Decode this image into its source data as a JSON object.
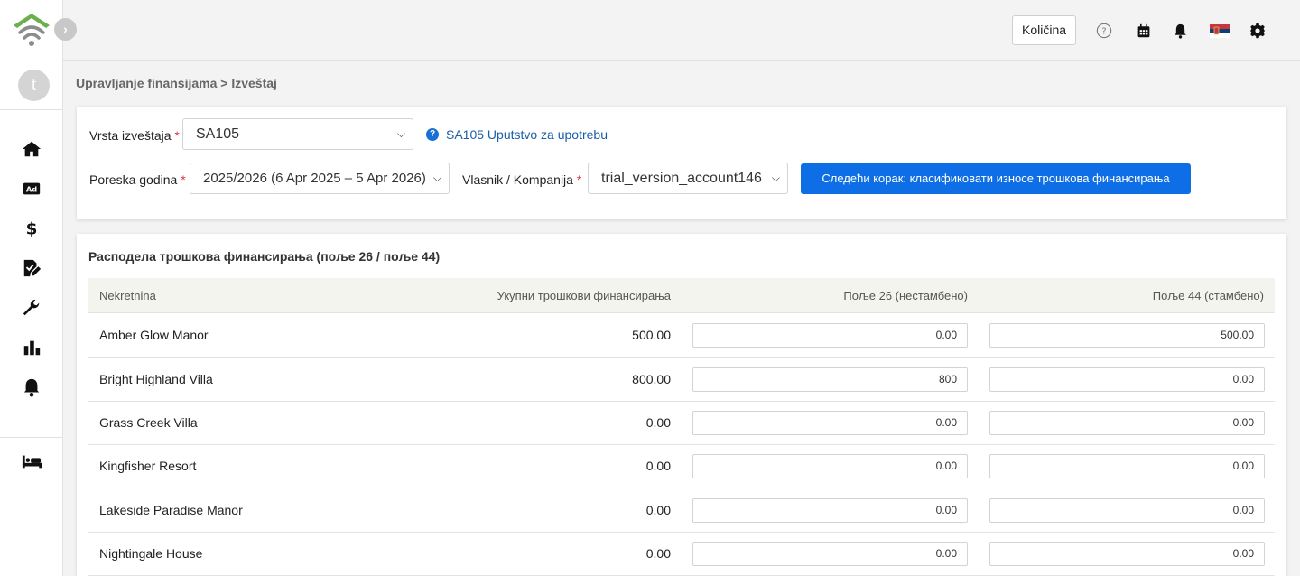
{
  "topbar": {
    "quantity_label": "Količina",
    "icons": [
      "help-icon",
      "calendar-icon",
      "bell-icon",
      "serbia-flag-icon",
      "gear-icon"
    ]
  },
  "sidebar": {
    "avatar_initial": "t",
    "icons": [
      "home-icon",
      "ad-icon",
      "dollar-icon",
      "document-edit-icon",
      "wrench-icon",
      "bar-chart-icon",
      "bell-icon",
      "bed-icon"
    ]
  },
  "breadcrumb": "Upravljanje finansijama > Izveštaj",
  "form": {
    "report_type_label": "Vrsta izveštaja",
    "report_type_value": "SA105",
    "help_link": "SA105 Uputstvo za upotrebu",
    "tax_year_label": "Poreska godina",
    "tax_year_value": "2025/2026 (6 Apr 2025 – 5 Apr 2026)",
    "owner_label": "Vlasnik / Kompanija",
    "owner_value": "trial_version_account146",
    "required_mark": "*",
    "next_button": "Следећи корак: класификовати износе трошкова финансирања"
  },
  "table": {
    "title": "Расподела трошкова финансирања (поље 26 / поље 44)",
    "columns": [
      "Nekretnina",
      "Укупни трошкови финансирања",
      "Поље 26 (нестамбено)",
      "Поље 44 (стамбено)"
    ],
    "rows": [
      {
        "name": "Amber Glow Manor",
        "total": "500.00",
        "box26": "0.00",
        "box44": "500.00"
      },
      {
        "name": "Bright Highland Villa",
        "total": "800.00",
        "box26": "800",
        "box44": "0.00"
      },
      {
        "name": "Grass Creek Villa",
        "total": "0.00",
        "box26": "0.00",
        "box44": "0.00"
      },
      {
        "name": "Kingfisher Resort",
        "total": "0.00",
        "box26": "0.00",
        "box44": "0.00"
      },
      {
        "name": "Lakeside Paradise Manor",
        "total": "0.00",
        "box26": "0.00",
        "box44": "0.00"
      },
      {
        "name": "Nightingale House",
        "total": "0.00",
        "box26": "0.00",
        "box44": "0.00"
      }
    ]
  },
  "colors": {
    "primary": "#0d6ee6",
    "required": "#dc3545",
    "logo_green": "#6ab04c"
  }
}
